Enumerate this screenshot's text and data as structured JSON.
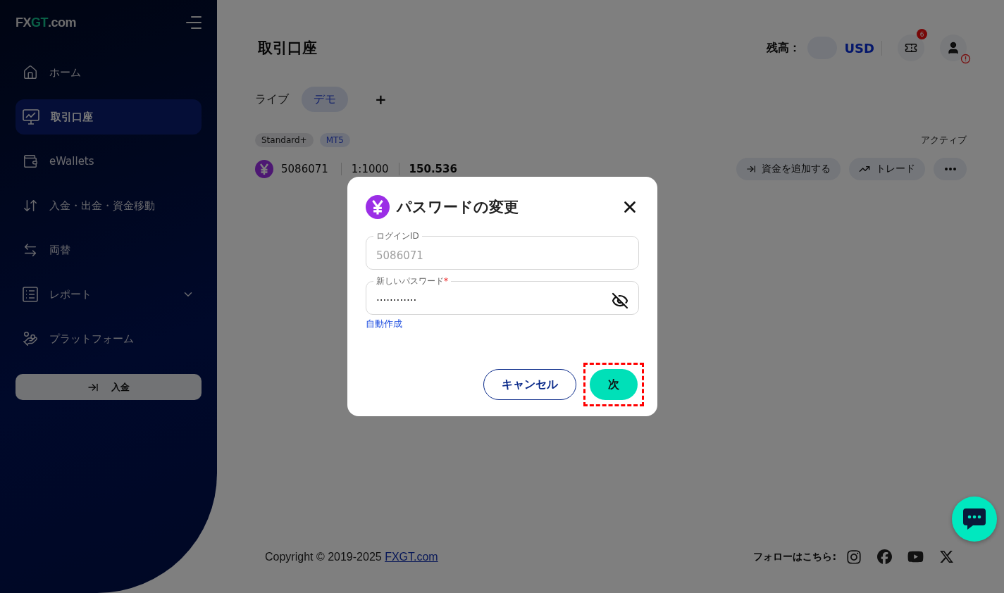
{
  "sidebar": {
    "logo": {
      "lead": "FX",
      "accent": "GT",
      "tail": ".com"
    },
    "items": [
      {
        "kind": "home",
        "label": "ホーム",
        "selected": false
      },
      {
        "kind": "accounts",
        "label": "取引口座",
        "selected": true
      },
      {
        "kind": "wallet",
        "label": "eWallets",
        "selected": false
      },
      {
        "kind": "transfer",
        "label": "入金・出金・資金移動",
        "selected": false
      },
      {
        "kind": "exchange",
        "label": "両替",
        "selected": false
      },
      {
        "kind": "report",
        "label": "レポート",
        "selected": false,
        "expanded": false
      },
      {
        "kind": "platform",
        "label": "プラットフォーム",
        "selected": false
      }
    ],
    "deposit_button": "入金"
  },
  "header": {
    "title": "取引口座",
    "balance_label": "残高：",
    "currency": "USD",
    "notification_count": "6"
  },
  "tabs": [
    {
      "label": "ライブ",
      "selected": false
    },
    {
      "label": "デモ",
      "selected": true
    }
  ],
  "add_tab": "+",
  "account": {
    "tags": [
      "Standard+",
      "MT5"
    ],
    "status": "アクティブ",
    "id": "5086071",
    "leverage": "1:1000",
    "balance": "150.536",
    "actions": [
      {
        "kind": "deposit",
        "label": "資金を追加する"
      },
      {
        "kind": "trade",
        "label": "トレード"
      }
    ]
  },
  "dialog": {
    "title": "パスワードの変更",
    "fields": [
      {
        "label": "ログインID",
        "value": "5086071",
        "disabled": true
      },
      {
        "label": "新しいパスワード",
        "required_mark": "*",
        "value": "············",
        "disabled": false
      }
    ],
    "generate_link": "自動作成",
    "cancel_button": "キャンセル",
    "next_button": {
      "label": "次",
      "highlighted": true
    }
  },
  "footer": {
    "copyright": "Copyright © 2019-2025 ",
    "copyright_link": "FXGT.com",
    "follow_label": "フォローはこちら:"
  }
}
